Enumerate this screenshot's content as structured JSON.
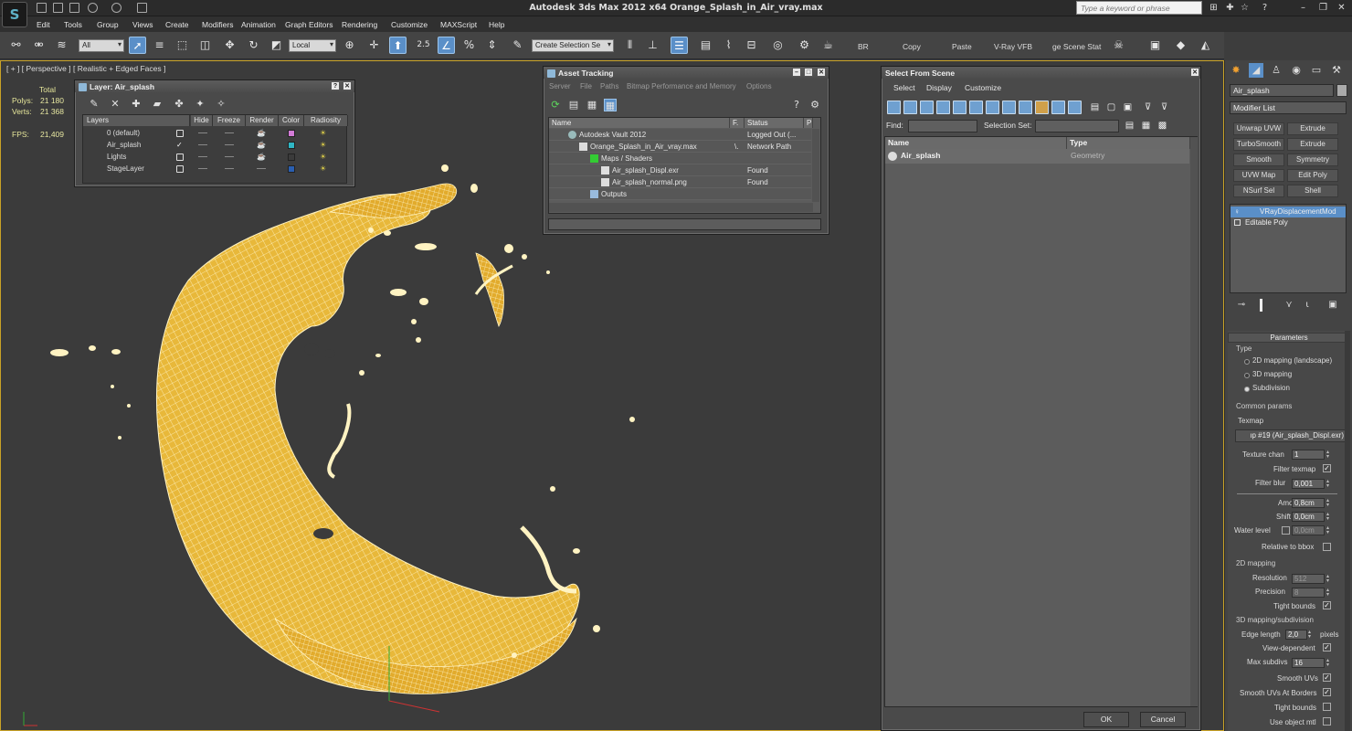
{
  "window": {
    "title": "Autodesk 3ds Max  2012 x64      Orange_Splash_in_Air_vray.max",
    "search_placeholder": "Type a keyword or phrase",
    "logo_glyph": "S"
  },
  "menu": [
    "Edit",
    "Tools",
    "Group",
    "Views",
    "Create",
    "Modifiers",
    "Animation",
    "Graph Editors",
    "Rendering",
    "Customize",
    "MAXScript",
    "Help"
  ],
  "toolbar": {
    "selection_filter": "All",
    "coord_system": "Local",
    "snap_value": "2.5",
    "named_selection_placeholder": "Create Selection Se",
    "text_buttons": [
      "BR",
      "Copy",
      "Paste",
      "V-Ray VFB",
      "ge Scene Stat"
    ]
  },
  "viewport": {
    "label": "[ + ] [ Perspective ] [ Realistic + Edged Faces ]",
    "stats": {
      "total_label": "Total",
      "polys_label": "Polys:",
      "polys_value": "21 180",
      "verts_label": "Verts:",
      "verts_value": "21 368",
      "fps_label": "FPS:",
      "fps_value": "21,409"
    }
  },
  "layer_window": {
    "title": "Layer: Air_splash",
    "columns": [
      "Layers",
      "Hide",
      "Freeze",
      "Render",
      "Color",
      "Radiosity"
    ],
    "rows": [
      {
        "name": "0 (default)",
        "color": "#d27bd6",
        "current": false
      },
      {
        "name": "Air_splash",
        "color": "#2fb6c4",
        "current": true
      },
      {
        "name": "Lights",
        "color": "#3b3b3b",
        "current": false
      },
      {
        "name": "StageLayer",
        "color": "#2a5fb0",
        "current": false
      }
    ]
  },
  "asset_window": {
    "title": "Asset Tracking",
    "menu": [
      "Server",
      "File",
      "Paths",
      "Bitmap Performance and Memory",
      "Options"
    ],
    "columns": [
      "Name",
      "F.",
      "Status",
      "P"
    ],
    "rows": [
      {
        "name": "Autodesk Vault 2012",
        "f": "",
        "status": "Logged Out (..."
      },
      {
        "name": "Orange_Splash_in_Air_vray.max",
        "f": "\\.",
        "status": "Network Path"
      },
      {
        "name": "Maps / Shaders",
        "f": "",
        "status": ""
      },
      {
        "name": "Air_splash_Displ.exr",
        "f": "",
        "status": "Found"
      },
      {
        "name": "Air_splash_normal.png",
        "f": "",
        "status": "Found"
      },
      {
        "name": "Outputs",
        "f": "",
        "status": ""
      }
    ]
  },
  "select_from_scene": {
    "title": "Select From Scene",
    "menu": [
      "Select",
      "Display",
      "Customize"
    ],
    "find_label": "Find:",
    "selection_set_label": "Selection Set:",
    "columns": [
      "Name",
      "Type"
    ],
    "rows": [
      {
        "name": "Air_splash",
        "type": "Geometry"
      }
    ],
    "ok": "OK",
    "cancel": "Cancel"
  },
  "command_panel": {
    "object_name": "Air_splash",
    "modifier_list": "Modifier List",
    "modifier_buttons": [
      "Unwrap UVW",
      "Extrude",
      "TurboSmooth",
      "Extrude",
      "Smooth",
      "Symmetry",
      "UVW Map",
      "Edit Poly",
      "NSurf Sel",
      "Shell"
    ],
    "stack": [
      "VRayDisplacementMod",
      "Editable Poly"
    ],
    "params": {
      "rollout": "Parameters",
      "type_group": "Type",
      "type_options": [
        "2D mapping (landscape)",
        "3D mapping",
        "Subdivision"
      ],
      "common_group": "Common params",
      "texmap_label": "Texmap",
      "texmap_value": "ıp #19 (Air_splash_Displ.exr)",
      "texture_chan_label": "Texture chan",
      "texture_chan": "1",
      "filter_texmap_label": "Filter texmap",
      "filter_blur_label": "Filter blur",
      "filter_blur": "0,001",
      "amount_label": "Amount",
      "amount": "0,8cm",
      "shift_label": "Shift",
      "shift": "0,0cm",
      "water_level_label": "Water level",
      "water_level": "0,0cm",
      "relative_bbox_label": "Relative to bbox",
      "mapping2d_group": "2D mapping",
      "resolution_label": "Resolution",
      "resolution": "512",
      "precision_label": "Precision",
      "precision": "8",
      "tight_bounds_label": "Tight bounds",
      "mapping3d_group": "3D mapping/subdivision",
      "edge_length_label": "Edge length",
      "edge_length": "2,0",
      "pixels_label": "pixels",
      "view_dependent_label": "View-dependent",
      "max_subdivs_label": "Max subdivs",
      "max_subdivs": "16",
      "smooth_uvs_label": "Smooth UVs",
      "smooth_uvs_borders_label": "Smooth UVs At Borders",
      "tight_bounds2_label": "Tight bounds",
      "use_object_mtl_label": "Use object mtl"
    }
  },
  "colors": {
    "mesh_fill": "#e8b83a",
    "mesh_wire": "#fff3c2",
    "viewport_border": "#c9a227",
    "selection_blue": "#5a8fc8"
  }
}
